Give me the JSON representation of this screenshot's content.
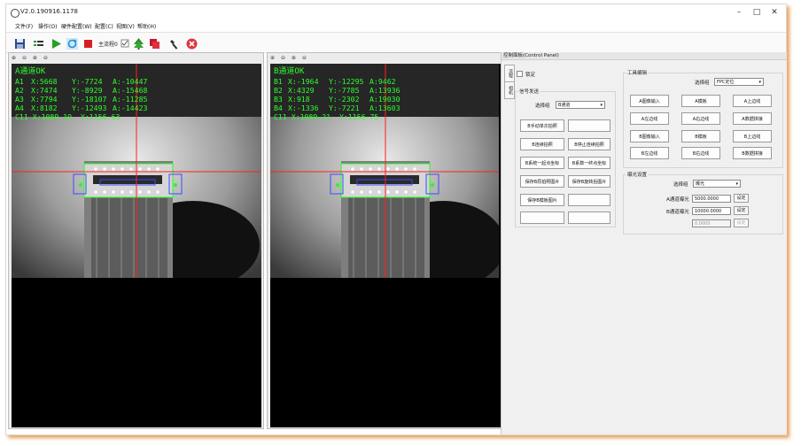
{
  "window": {
    "title": "V2.0.190916.1178",
    "minimize": "–",
    "maximize": "□",
    "close": "✕"
  },
  "menu": [
    "文件(F)",
    "操作(O)",
    "硬件配置(W)",
    "配置(C)",
    "视图(V)",
    "帮助(H)"
  ],
  "toolbar": {
    "flow_label": "主流程0"
  },
  "zoom_controls": [
    "⊕",
    "⊖",
    "⊕",
    "⊖"
  ],
  "camera_a": {
    "status": "A通道OK",
    "rows": [
      {
        "id": "A1",
        "x": "X:5668",
        "y": "Y:-7724",
        "a": "A:-10447"
      },
      {
        "id": "A2",
        "x": "X:7474",
        "y": "Y:-8929",
        "a": "A:-15468"
      },
      {
        "id": "A3",
        "x": "X:7794",
        "y": "Y:-18107",
        "a": "A:-11285"
      },
      {
        "id": "A4",
        "x": "X:8182",
        "y": "Y:-12493",
        "a": "A:-14423"
      }
    ],
    "center": "C11 X:1089.19  Y:1156.63"
  },
  "camera_b": {
    "status": "B通道OK",
    "rows": [
      {
        "id": "B1",
        "x": "X:-1964",
        "y": "Y:-12295",
        "a": "A:9462"
      },
      {
        "id": "B2",
        "x": "X:4329",
        "y": "Y:-7785",
        "a": "A:13936"
      },
      {
        "id": "B3",
        "x": "X:918",
        "y": "Y:-2302",
        "a": "A:19030"
      },
      {
        "id": "B4",
        "x": "X:-1336",
        "y": "Y:-7221",
        "a": "A:13603"
      }
    ],
    "center": "C11 X:1089.21  Y:1156.75"
  },
  "control_panel": {
    "title": "控制面板(Control Panel)",
    "vtabs": [
      "流程",
      "相机"
    ],
    "lock_label": "锁定",
    "signal_group": {
      "title": "信号发送",
      "select_label": "选择组",
      "select_value": "B通道",
      "buttons": [
        "B手动单次拍照",
        "",
        "B连续拍照",
        "B停止连续拍照",
        "B系统一起点坐标",
        "B系数一终点坐标",
        "保存B原拍照图片",
        "保存B旋转后图片",
        "保存B模板图片",
        "",
        "",
        ""
      ]
    },
    "tool_group": {
      "title": "工具编辑",
      "select_label": "选择组",
      "select_value": "FPC定位",
      "buttons": [
        "A图像输入",
        "A模板",
        "A上边线",
        "A左边线",
        "A右边线",
        "A数据拼接",
        "B图像输入",
        "B模板",
        "B上边线",
        "B左边线",
        "B右边线",
        "B数据拼接"
      ]
    },
    "exposure_group": {
      "title": "曝光设置",
      "select_label": "选择组",
      "select_value": "曝光",
      "rows": [
        {
          "label": "A通道曝光",
          "value": "5000.0000",
          "button": "设定",
          "disabled": false
        },
        {
          "label": "B通道曝光",
          "value": "10000.0000",
          "button": "设定",
          "disabled": false
        },
        {
          "label": "",
          "value": "0.0000",
          "button": "设定",
          "disabled": true
        }
      ]
    }
  }
}
